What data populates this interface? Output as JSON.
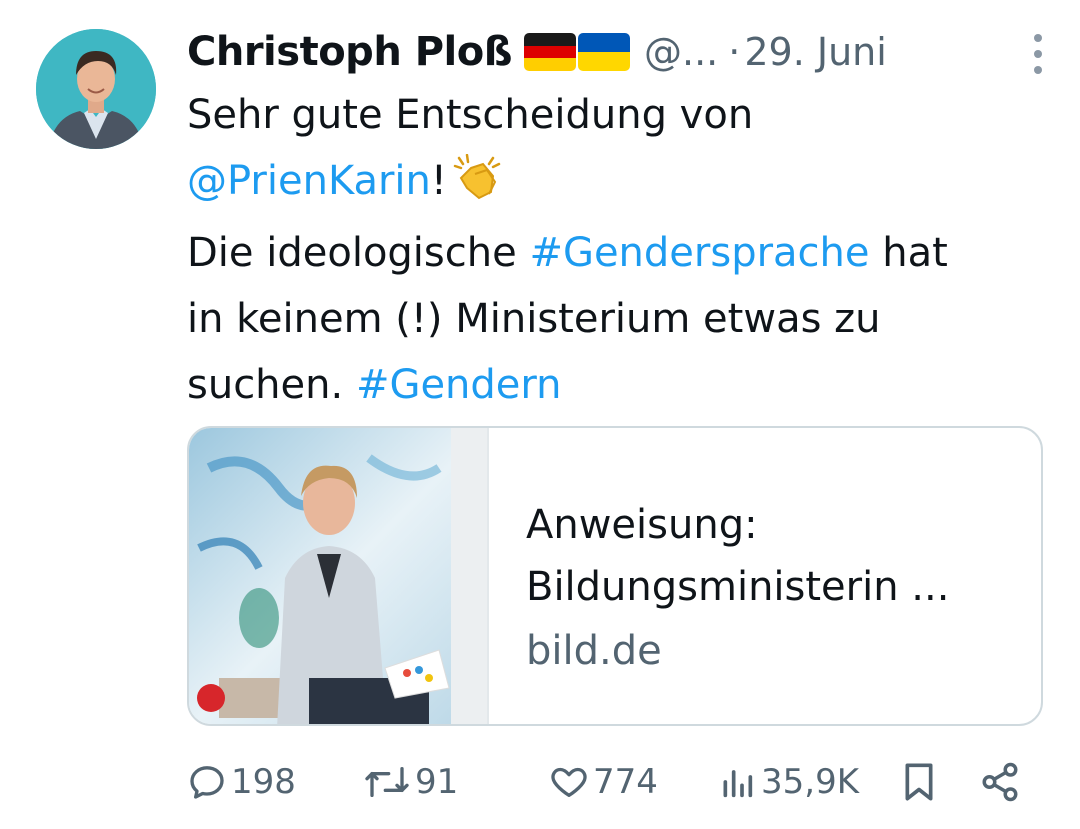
{
  "author": {
    "name": "Christoph Ploß",
    "handle": "@...",
    "separator": "·",
    "date": "29. Juni"
  },
  "tweet": {
    "line1": "Sehr gute Entscheidung von",
    "mention": "@PrienKarin",
    "after_mention": "!",
    "line3_pre": "Die ideologische",
    "hashtag1": "#Gendersprache",
    "line3_post": "hat",
    "line4": "in keinem (!) Ministerium etwas zu",
    "line5_pre": "suchen.",
    "hashtag2": "#Gendern"
  },
  "card": {
    "title_line1": "Anweisung:",
    "title_line2": "Bildungsministerin ...",
    "domain": "bild.de"
  },
  "actions": {
    "replies": "198",
    "reposts": "91",
    "likes": "774",
    "views": "35,9K"
  },
  "icons": {
    "avatar": "profile-photo",
    "flag1": "germany-flag-icon",
    "flag2": "ukraine-flag-icon",
    "emoji": "clapping-hands-icon",
    "more": "more-vertical-icon",
    "reply": "reply-icon",
    "repost": "repost-icon",
    "like": "heart-icon",
    "views": "views-icon",
    "bookmark": "bookmark-icon",
    "share": "share-icon"
  },
  "colors": {
    "link": "#1d9bf0",
    "secondary_text": "#536471",
    "primary_text": "#0f1419",
    "avatar_bg": "#3fb7c3"
  }
}
